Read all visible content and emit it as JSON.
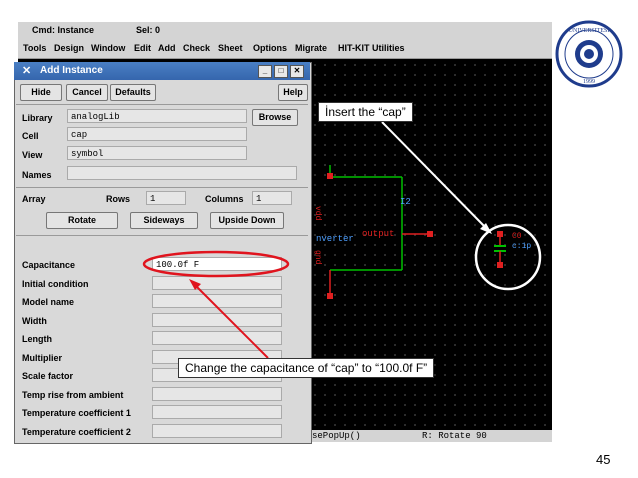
{
  "cad": {
    "cmd_label": "Cmd: Instance",
    "sel_label": "Sel: 0",
    "menu": [
      "Tools",
      "Design",
      "Window",
      "Edit",
      "Add",
      "Check",
      "Sheet",
      "Options",
      "Migrate",
      "HIT-KIT Utilities"
    ],
    "status_left": "sePopUp()",
    "status_right": "R: Rotate 90"
  },
  "dialog": {
    "title": "Add Instance",
    "buttons": {
      "hide": "Hide",
      "cancel": "Cancel",
      "defaults": "Defaults",
      "help": "Help",
      "browse": "Browse",
      "rotate": "Rotate",
      "sideways": "Sideways",
      "upside_down": "Upside Down"
    },
    "library": {
      "label": "Library",
      "value": "analogLib"
    },
    "cell": {
      "label": "Cell",
      "value": "cap"
    },
    "view": {
      "label": "View",
      "value": "symbol"
    },
    "names": {
      "label": "Names",
      "value": ""
    },
    "array": {
      "label": "Array",
      "rows_label": "Rows",
      "rows": "1",
      "columns_label": "Columns",
      "columns": "1"
    },
    "params": [
      {
        "label": "Capacitance",
        "value": "100.0f F"
      },
      {
        "label": "Initial condition",
        "value": ""
      },
      {
        "label": "Model name",
        "value": ""
      },
      {
        "label": "Width",
        "value": ""
      },
      {
        "label": "Length",
        "value": ""
      },
      {
        "label": "Multiplier",
        "value": ""
      },
      {
        "label": "Scale factor",
        "value": ""
      },
      {
        "label": "Temp rise from ambient",
        "value": ""
      },
      {
        "label": "Temperature coefficient 1",
        "value": ""
      },
      {
        "label": "Temperature coefficient 2",
        "value": ""
      }
    ]
  },
  "schematic": {
    "instance_name": "I2",
    "vdd_label": "vdd",
    "gnd_label": "gnd",
    "inverter_label": "nverter",
    "output_label": "output",
    "cap_name": "C0",
    "cap_value": "c:1p"
  },
  "annotations": {
    "insert_cap": "İnsert the “cap”",
    "change_cap": "Change the capacitance of “cap” to “100.0f F”"
  },
  "page_number": "45",
  "colors": {
    "accent_red": "#e0141e",
    "schematic_red": "#e02020",
    "wire_green": "#00c000",
    "text_cyan": "#4fa0ff",
    "logo_blue": "#1f3c8c"
  }
}
